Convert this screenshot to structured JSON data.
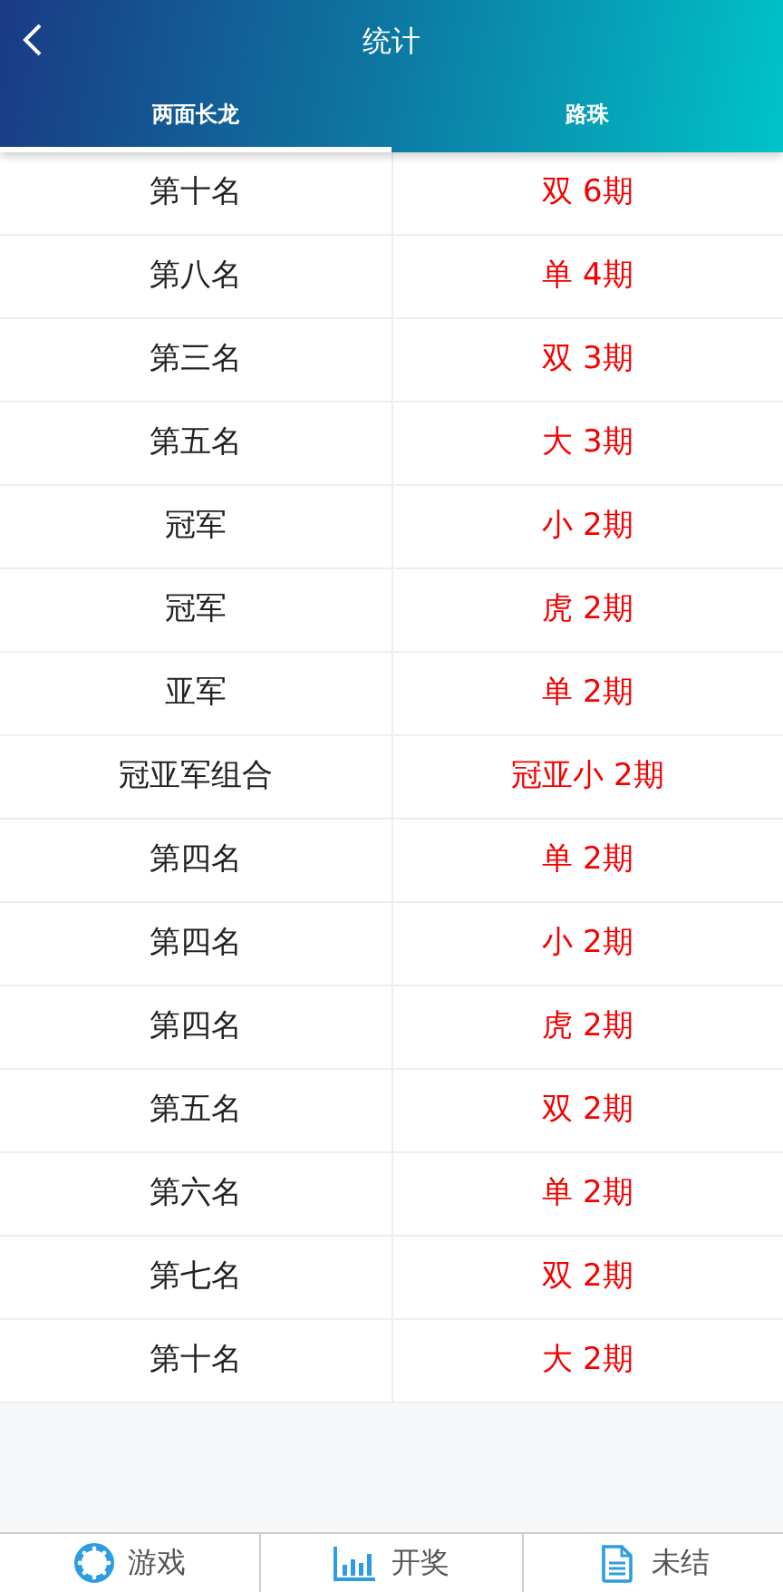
{
  "header": {
    "title": "统计"
  },
  "tabs": [
    {
      "label": "两面长龙",
      "selected": true
    },
    {
      "label": "路珠",
      "selected": false
    }
  ],
  "rows": [
    {
      "name": "第十名",
      "result": "双 6期"
    },
    {
      "name": "第八名",
      "result": "单 4期"
    },
    {
      "name": "第三名",
      "result": "双 3期"
    },
    {
      "name": "第五名",
      "result": "大 3期"
    },
    {
      "name": "冠军",
      "result": "小 2期"
    },
    {
      "name": "冠军",
      "result": "虎 2期"
    },
    {
      "name": "亚军",
      "result": "单 2期"
    },
    {
      "name": "冠亚军组合",
      "result": "冠亚小 2期"
    },
    {
      "name": "第四名",
      "result": "单 2期"
    },
    {
      "name": "第四名",
      "result": "小 2期"
    },
    {
      "name": "第四名",
      "result": "虎 2期"
    },
    {
      "name": "第五名",
      "result": "双 2期"
    },
    {
      "name": "第六名",
      "result": "单 2期"
    },
    {
      "name": "第七名",
      "result": "双 2期"
    },
    {
      "name": "第十名",
      "result": "大 2期"
    }
  ],
  "bottom_nav": [
    {
      "kind": "games",
      "label": "游戏"
    },
    {
      "kind": "draw",
      "label": "开奖"
    },
    {
      "kind": "unsettled",
      "label": "未结"
    }
  ]
}
